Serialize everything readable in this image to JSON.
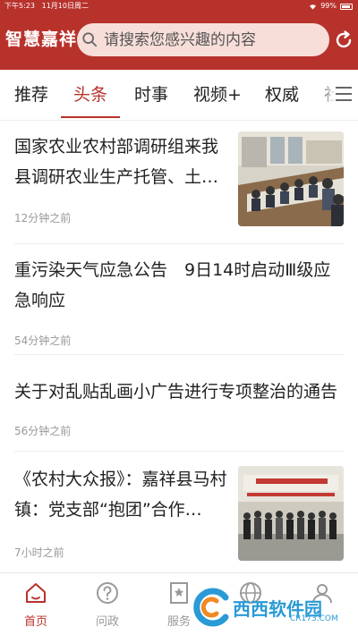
{
  "status": {
    "time": "下午5:23",
    "date": "11月10日周二",
    "battery": "99%"
  },
  "header": {
    "brand": "智慧嘉祥",
    "search_placeholder": "请搜索您感兴趣的内容",
    "accent_color": "#b8322c",
    "icons": [
      "search-icon",
      "refresh-icon"
    ]
  },
  "tabs": [
    {
      "label": "推荐",
      "active": false
    },
    {
      "label": "头条",
      "active": true
    },
    {
      "label": "时事",
      "active": false
    },
    {
      "label": "视频+",
      "active": false
    },
    {
      "label": "权威",
      "active": false
    },
    {
      "label": "社",
      "active": false
    }
  ],
  "news": [
    {
      "title": "国家农业农村部调研组来我县调研农业生产托管、土…",
      "time": "12分钟之前",
      "has_image": true
    },
    {
      "title": "重污染天气应急公告　9日14时启动Ⅲ级应急响应",
      "time": "54分钟之前",
      "has_image": false
    },
    {
      "title": "关于对乱贴乱画小广告进行专项整治的通告",
      "time": "56分钟之前",
      "has_image": false
    },
    {
      "title": "《农村大众报》：嘉祥县马村镇：党支部“抱团”合作…",
      "time": "7小时之前",
      "has_image": true
    }
  ],
  "bottom_nav": [
    {
      "label": "首页",
      "icon": "home-icon",
      "active": true
    },
    {
      "label": "问政",
      "icon": "question-icon",
      "active": false
    },
    {
      "label": "服务",
      "icon": "service-icon",
      "active": false
    },
    {
      "label": "",
      "icon": "globe-icon",
      "active": false
    },
    {
      "label": "",
      "icon": "user-icon",
      "active": false
    }
  ],
  "watermark": {
    "text": "西西软件园",
    "sub": "CR173.COM"
  }
}
